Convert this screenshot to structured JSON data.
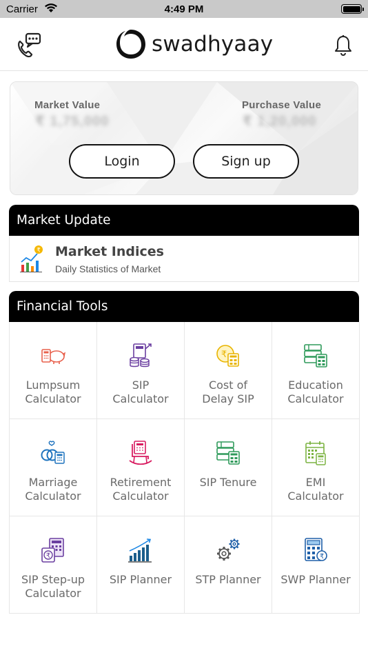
{
  "status_bar": {
    "carrier": "Carrier",
    "time": "4:49 PM"
  },
  "header": {
    "brand": "swadhyaay"
  },
  "portfolio": {
    "market_value_label": "Market Value",
    "market_value": "₹ 1,75,000",
    "purchase_value_label": "Purchase Value",
    "purchase_value": "₹ 1,20,000",
    "login_label": "Login",
    "signup_label": "Sign up"
  },
  "market_update": {
    "title": "Market Update",
    "item_title": "Market Indices",
    "item_subtitle": "Daily Statistics of Market"
  },
  "financial_tools": {
    "title": "Financial Tools",
    "tools": [
      {
        "label": "Lumpsum\nCalculator",
        "icon": "piggy-bank-calculator-icon",
        "color": "#e8604c"
      },
      {
        "label": "SIP\nCalculator",
        "icon": "coins-calculator-icon",
        "color": "#6b3fa0"
      },
      {
        "label": "Cost of\nDelay SIP",
        "icon": "rupee-coin-calculator-icon",
        "color": "#e8b400"
      },
      {
        "label": "Education\nCalculator",
        "icon": "books-calculator-icon",
        "color": "#2e9a5a"
      },
      {
        "label": "Marriage\nCalculator",
        "icon": "rings-calculator-icon",
        "color": "#1e73be"
      },
      {
        "label": "Retirement\nCalculator",
        "icon": "rocking-chair-icon",
        "color": "#d81b60"
      },
      {
        "label": "SIP Tenure",
        "icon": "books-calculator-green-icon",
        "color": "#2e9a5a"
      },
      {
        "label": "EMI\nCalculator",
        "icon": "calendar-calculator-icon",
        "color": "#7cb342"
      },
      {
        "label": "SIP Step-up\nCalculator",
        "icon": "stepup-calculator-icon",
        "color": "#6b3fa0"
      },
      {
        "label": "SIP Planner",
        "icon": "growth-chart-icon",
        "color": "#1b5e8c"
      },
      {
        "label": "STP Planner",
        "icon": "gears-icon",
        "color": "#1e5fa8"
      },
      {
        "label": "SWP Planner",
        "icon": "calculator-coin-icon",
        "color": "#1e5fa8"
      }
    ]
  }
}
